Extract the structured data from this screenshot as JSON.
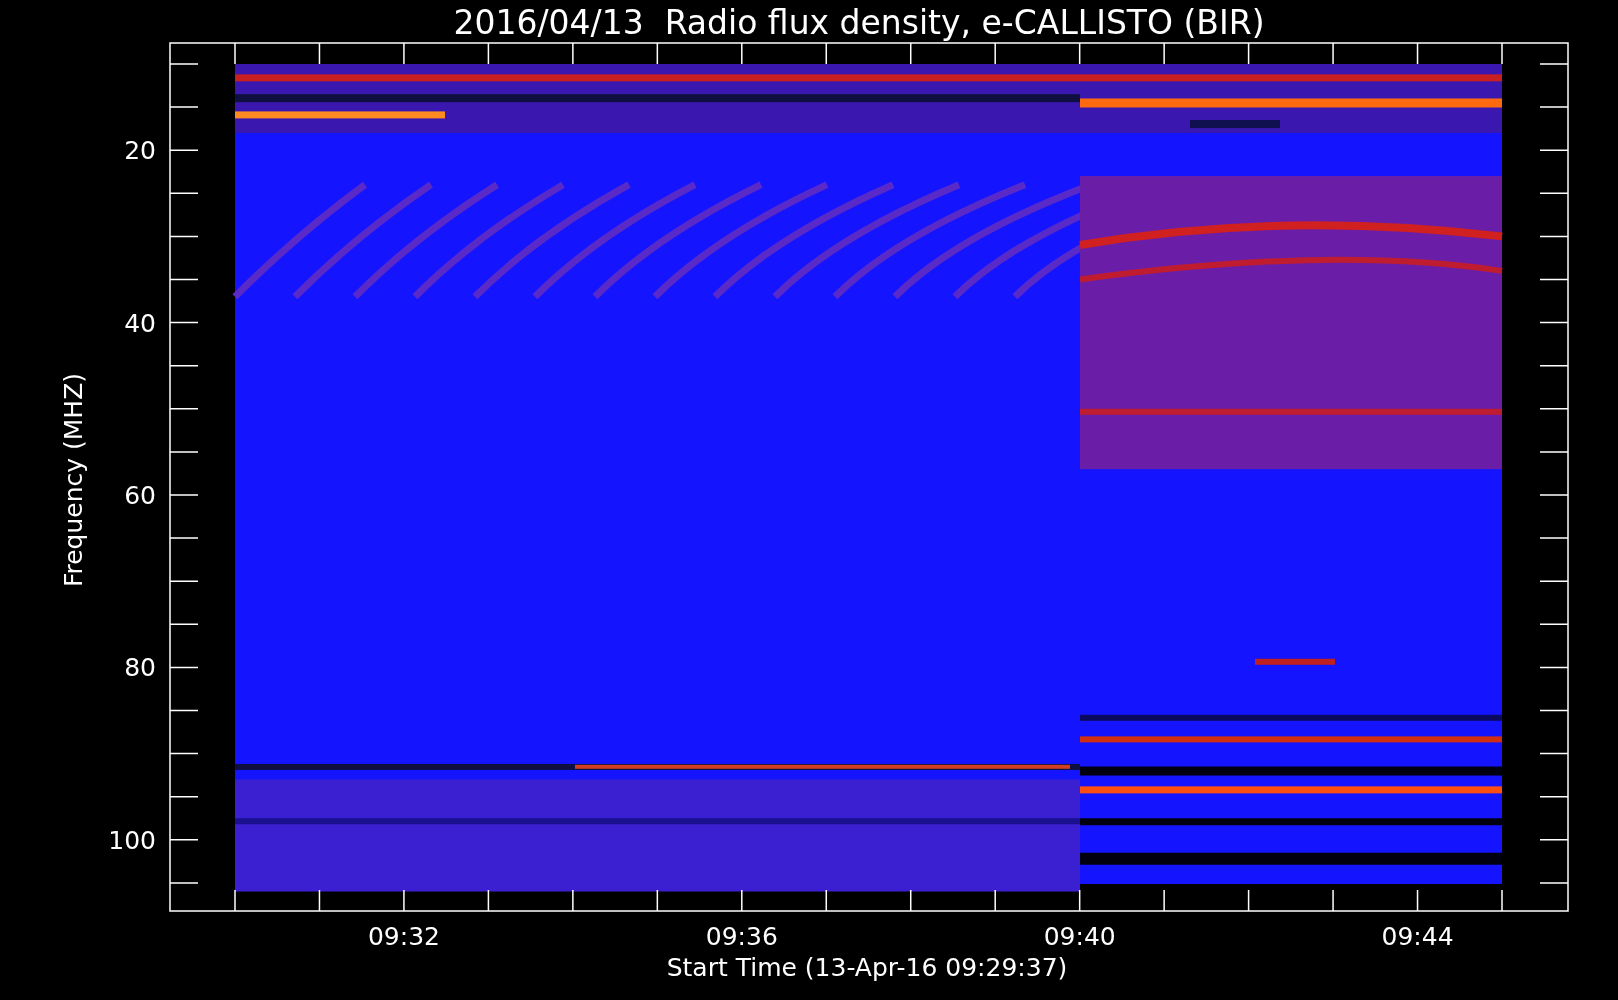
{
  "title": "2016/04/13  Radio flux density, e-CALLISTO (BIR)",
  "y_axis": {
    "label": "Frequency (MHZ)",
    "ticks": [
      "20",
      "40",
      "60",
      "80",
      "100"
    ]
  },
  "x_axis": {
    "label": "Start Time (13-Apr-16 09:29:37)",
    "ticks": [
      "09:32",
      "09:36",
      "09:40",
      "09:44"
    ]
  }
}
